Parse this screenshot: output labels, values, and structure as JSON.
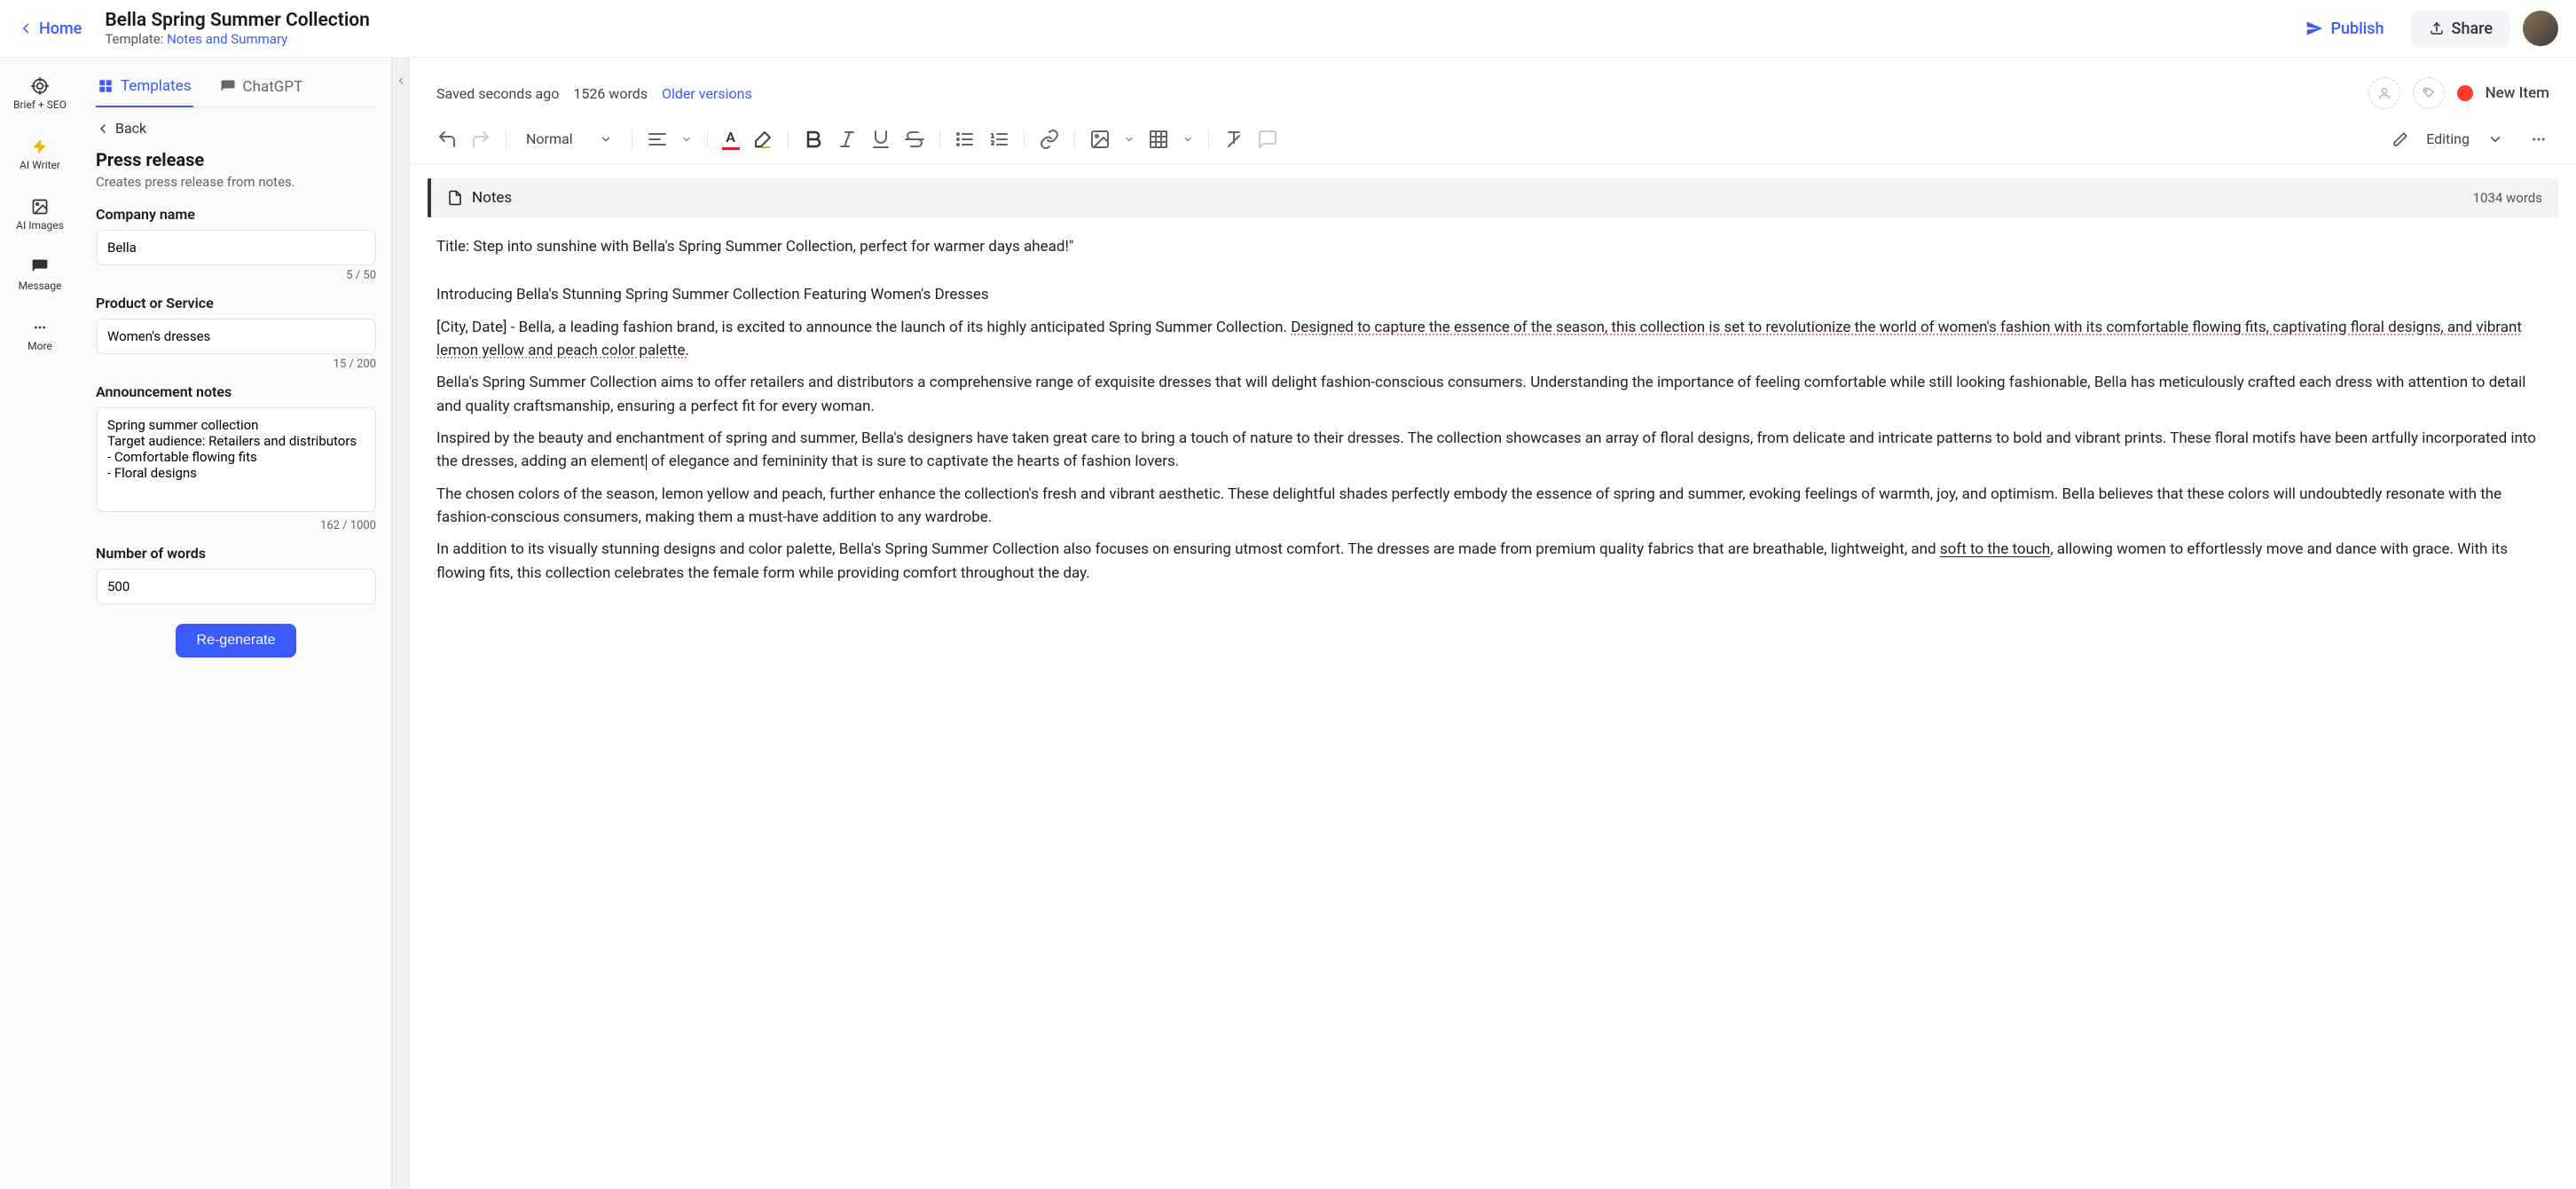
{
  "header": {
    "home": "Home",
    "title": "Bella Spring Summer Collection",
    "template_label": "Template: ",
    "template_link": "Notes and Summary",
    "publish": "Publish",
    "share": "Share"
  },
  "nav": {
    "brief": "Brief + SEO",
    "writer": "AI Writer",
    "images": "AI Images",
    "message": "Message",
    "more": "More"
  },
  "sidebar": {
    "tabs": {
      "templates": "Templates",
      "chatgpt": "ChatGPT"
    },
    "back": "Back",
    "panel_title": "Press release",
    "panel_desc": "Creates press release from notes.",
    "fields": {
      "company_label": "Company name",
      "company_value": "Bella",
      "company_counter": "5 / 50",
      "product_label": "Product or Service",
      "product_value": "Women's dresses",
      "product_counter": "15 / 200",
      "announcement_label": "Announcement notes",
      "announcement_value": "Spring summer collection\nTarget audience: Retailers and distributors\n- Comfortable flowing fits\n- Floral designs",
      "announcement_counter": "162 / 1000",
      "words_label": "Number of words",
      "words_value": "500"
    },
    "regenerate": "Re-generate"
  },
  "editor": {
    "saved": "Saved seconds ago",
    "word_count": "1526 words",
    "older": "Older versions",
    "new_item": "New Item",
    "style_normal": "Normal",
    "mode": "Editing",
    "notes_label": "Notes",
    "notes_wc": "1034 words"
  },
  "content": {
    "title_line": "Title: Step into sunshine with Bella's Spring Summer Collection, perfect for warmer days ahead!\"",
    "intro_heading": "Introducing Bella's Stunning Spring Summer Collection Featuring Women's Dresses",
    "p1_a": "[City, Date] - Bella, a leading fashion brand, is excited to announce the launch of its highly anticipated Spring Summer Collection. ",
    "p1_b": "Designed to capture the essence of the season, this collection is set to revolutionize the world of women's fashion with its comfortable flowing fits, captivating floral designs, and vibrant lemon yellow and peach color palette.",
    "p2": "Bella's Spring Summer Collection aims to offer retailers and distributors a comprehensive range of exquisite dresses that will delight fashion-conscious consumers. Understanding the importance of feeling comfortable while still looking fashionable, Bella has meticulously crafted each dress with attention to detail and quality craftsmanship, ensuring a perfect fit for every woman.",
    "p3_a": "Inspired by the beauty and enchantment of spring and summer, Bella's designers have taken great care to bring a touch of nature to their dresses. The collection showcases an array of floral designs, from delicate and intricate patterns to bold and vibrant prints. These floral motifs have been artfully incorporated into the dresses, adding an element",
    "p3_b": "of elegance and femininity that is sure to captivate the hearts of fashion lovers.",
    "p4": "The chosen colors of the season, lemon yellow and peach, further enhance the collection's fresh and vibrant aesthetic. These delightful shades perfectly embody the essence of spring and summer, evoking feelings of warmth, joy, and optimism. Bella believes that these colors will undoubtedly resonate with the fashion-conscious consumers, making them a must-have addition to any wardrobe.",
    "p5_a": "In addition to its visually stunning designs and color palette, Bella's Spring Summer Collection also focuses on ensuring utmost comfort. The dresses are made from premium quality fabrics that are breathable, lightweight, and ",
    "p5_b": "soft to the touch",
    "p5_c": ", allowing women to effortlessly move and dance with grace. With its flowing fits, this collection celebrates the female form while providing comfort throughout the day."
  }
}
